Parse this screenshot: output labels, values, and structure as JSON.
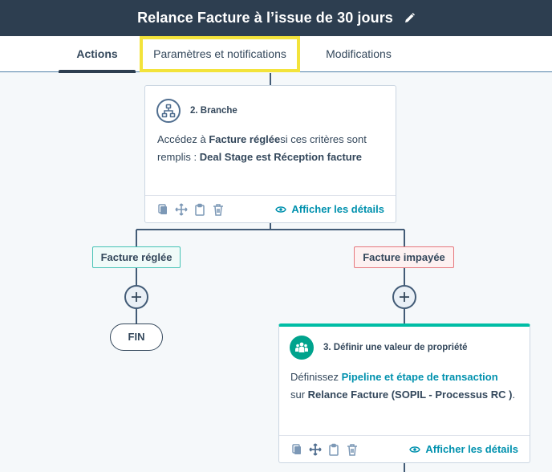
{
  "header": {
    "title": "Relance Facture à l’issue de 30 jours"
  },
  "tabs": [
    {
      "label": "Actions"
    },
    {
      "label": "Paramètres et notifications"
    },
    {
      "label": "Modifications"
    }
  ],
  "branch_card": {
    "title": "2. Branche",
    "line1_prefix": "Accédez à ",
    "line1_bold": "Facture réglée",
    "line1_suffix": "si ces critères sont",
    "line2_prefix": "remplis : ",
    "line2_bold": "Deal Stage est Réception facture",
    "details": "Afficher les détails"
  },
  "branches": {
    "left_label": "Facture réglée",
    "right_label": "Facture impayée",
    "end_label": "FIN"
  },
  "property_card": {
    "title": "3. Définir une valeur de propriété",
    "line1_prefix": "Définissez ",
    "line1_link": "Pipeline et étape de transaction",
    "line2_prefix": "sur ",
    "line2_bold": "Relance Facture (SOPIL - Processus RC )",
    "line2_suffix": ".",
    "details": "Afficher les détails"
  },
  "colors": {
    "header_bg": "#2d3e50",
    "highlight": "#f3e33b",
    "link": "#0091ae",
    "green_accent": "#00bda5",
    "branch_green": "#45c3b5",
    "branch_red": "#e6777d"
  },
  "icons": [
    "edit-icon",
    "branch-icon",
    "copy-icon",
    "move-icon",
    "clipboard-icon",
    "delete-icon",
    "eye-icon",
    "plus-icon",
    "users-icon"
  ]
}
